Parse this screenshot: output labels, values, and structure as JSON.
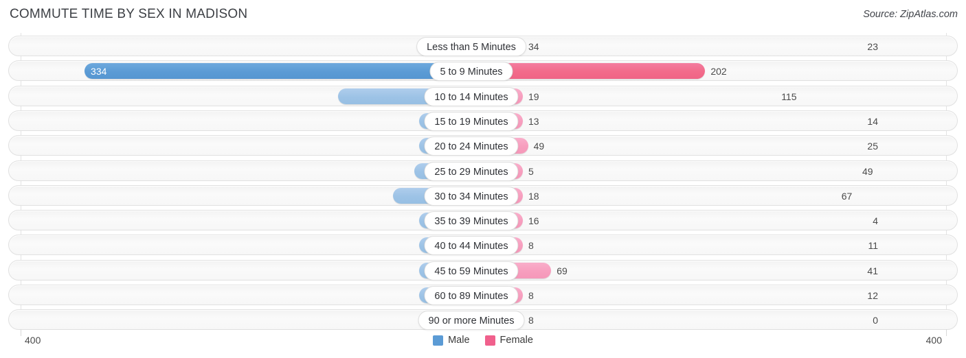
{
  "header": {
    "title": "COMMUTE TIME BY SEX IN MADISON",
    "source": "Source: ZipAtlas.com"
  },
  "legend": {
    "male_label": "Male",
    "female_label": "Female",
    "male_color": "#5b9bd5",
    "female_color": "#f0608c"
  },
  "axis": {
    "left_label": "400",
    "right_label": "400",
    "max": 400
  },
  "colors": {
    "male": "#9dc3e6",
    "female": "#f79ebe",
    "male_highlight": "#5b9bd5",
    "female_highlight": "#f26b8a"
  },
  "chart_data": {
    "type": "bar",
    "subtype": "diverging-bidirectional-bar",
    "title": "COMMUTE TIME BY SEX IN MADISON",
    "xlabel": "",
    "ylabel": "",
    "xlim": [
      400,
      400
    ],
    "grid": true,
    "legend_position": "bottom-center",
    "categories": [
      "Less than 5 Minutes",
      "5 to 9 Minutes",
      "10 to 14 Minutes",
      "15 to 19 Minutes",
      "20 to 24 Minutes",
      "25 to 29 Minutes",
      "30 to 34 Minutes",
      "35 to 39 Minutes",
      "40 to 44 Minutes",
      "45 to 59 Minutes",
      "60 to 89 Minutes",
      "90 or more Minutes"
    ],
    "series": [
      {
        "name": "Male",
        "direction": "left",
        "values": [
          23,
          334,
          115,
          14,
          25,
          49,
          67,
          4,
          11,
          41,
          12,
          0
        ]
      },
      {
        "name": "Female",
        "direction": "right",
        "values": [
          34,
          202,
          19,
          13,
          49,
          5,
          18,
          16,
          8,
          69,
          8,
          8
        ]
      }
    ],
    "highlight_row_index": 1
  },
  "rows": [
    {
      "category": "Less than 5 Minutes",
      "male": "23",
      "female": "34",
      "male_value": 23,
      "female_value": 34,
      "highlight": false
    },
    {
      "category": "5 to 9 Minutes",
      "male": "334",
      "female": "202",
      "male_value": 334,
      "female_value": 202,
      "highlight": true
    },
    {
      "category": "10 to 14 Minutes",
      "male": "115",
      "female": "19",
      "male_value": 115,
      "female_value": 19,
      "highlight": false
    },
    {
      "category": "15 to 19 Minutes",
      "male": "14",
      "female": "13",
      "male_value": 14,
      "female_value": 13,
      "highlight": false
    },
    {
      "category": "20 to 24 Minutes",
      "male": "25",
      "female": "49",
      "male_value": 25,
      "female_value": 49,
      "highlight": false
    },
    {
      "category": "25 to 29 Minutes",
      "male": "49",
      "female": "5",
      "male_value": 49,
      "female_value": 5,
      "highlight": false
    },
    {
      "category": "30 to 34 Minutes",
      "male": "67",
      "female": "18",
      "male_value": 67,
      "female_value": 18,
      "highlight": false
    },
    {
      "category": "35 to 39 Minutes",
      "male": "4",
      "female": "16",
      "male_value": 4,
      "female_value": 16,
      "highlight": false
    },
    {
      "category": "40 to 44 Minutes",
      "male": "11",
      "female": "8",
      "male_value": 11,
      "female_value": 8,
      "highlight": false
    },
    {
      "category": "45 to 59 Minutes",
      "male": "41",
      "female": "69",
      "male_value": 41,
      "female_value": 69,
      "highlight": false
    },
    {
      "category": "60 to 89 Minutes",
      "male": "12",
      "female": "8",
      "male_value": 12,
      "female_value": 8,
      "highlight": false
    },
    {
      "category": "90 or more Minutes",
      "male": "0",
      "female": "8",
      "male_value": 0,
      "female_value": 8,
      "highlight": false
    }
  ]
}
